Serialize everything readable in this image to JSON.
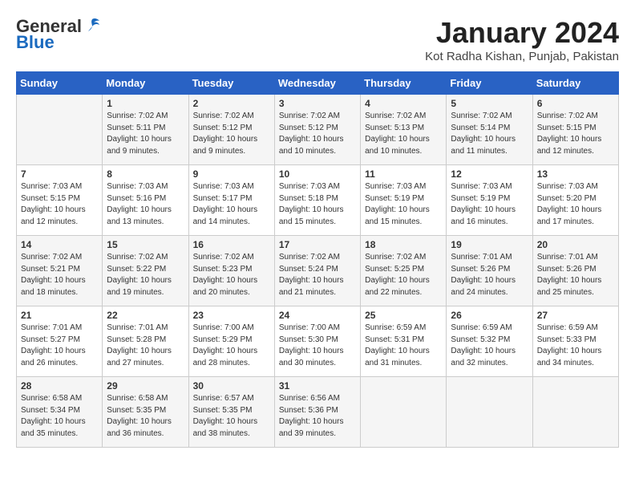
{
  "header": {
    "logo_general": "General",
    "logo_blue": "Blue",
    "month_title": "January 2024",
    "location": "Kot Radha Kishan, Punjab, Pakistan"
  },
  "calendar": {
    "days_of_week": [
      "Sunday",
      "Monday",
      "Tuesday",
      "Wednesday",
      "Thursday",
      "Friday",
      "Saturday"
    ],
    "weeks": [
      [
        {
          "day": "",
          "info": ""
        },
        {
          "day": "1",
          "info": "Sunrise: 7:02 AM\nSunset: 5:11 PM\nDaylight: 10 hours\nand 9 minutes."
        },
        {
          "day": "2",
          "info": "Sunrise: 7:02 AM\nSunset: 5:12 PM\nDaylight: 10 hours\nand 9 minutes."
        },
        {
          "day": "3",
          "info": "Sunrise: 7:02 AM\nSunset: 5:12 PM\nDaylight: 10 hours\nand 10 minutes."
        },
        {
          "day": "4",
          "info": "Sunrise: 7:02 AM\nSunset: 5:13 PM\nDaylight: 10 hours\nand 10 minutes."
        },
        {
          "day": "5",
          "info": "Sunrise: 7:02 AM\nSunset: 5:14 PM\nDaylight: 10 hours\nand 11 minutes."
        },
        {
          "day": "6",
          "info": "Sunrise: 7:02 AM\nSunset: 5:15 PM\nDaylight: 10 hours\nand 12 minutes."
        }
      ],
      [
        {
          "day": "7",
          "info": "Sunrise: 7:03 AM\nSunset: 5:15 PM\nDaylight: 10 hours\nand 12 minutes."
        },
        {
          "day": "8",
          "info": "Sunrise: 7:03 AM\nSunset: 5:16 PM\nDaylight: 10 hours\nand 13 minutes."
        },
        {
          "day": "9",
          "info": "Sunrise: 7:03 AM\nSunset: 5:17 PM\nDaylight: 10 hours\nand 14 minutes."
        },
        {
          "day": "10",
          "info": "Sunrise: 7:03 AM\nSunset: 5:18 PM\nDaylight: 10 hours\nand 15 minutes."
        },
        {
          "day": "11",
          "info": "Sunrise: 7:03 AM\nSunset: 5:19 PM\nDaylight: 10 hours\nand 15 minutes."
        },
        {
          "day": "12",
          "info": "Sunrise: 7:03 AM\nSunset: 5:19 PM\nDaylight: 10 hours\nand 16 minutes."
        },
        {
          "day": "13",
          "info": "Sunrise: 7:03 AM\nSunset: 5:20 PM\nDaylight: 10 hours\nand 17 minutes."
        }
      ],
      [
        {
          "day": "14",
          "info": "Sunrise: 7:02 AM\nSunset: 5:21 PM\nDaylight: 10 hours\nand 18 minutes."
        },
        {
          "day": "15",
          "info": "Sunrise: 7:02 AM\nSunset: 5:22 PM\nDaylight: 10 hours\nand 19 minutes."
        },
        {
          "day": "16",
          "info": "Sunrise: 7:02 AM\nSunset: 5:23 PM\nDaylight: 10 hours\nand 20 minutes."
        },
        {
          "day": "17",
          "info": "Sunrise: 7:02 AM\nSunset: 5:24 PM\nDaylight: 10 hours\nand 21 minutes."
        },
        {
          "day": "18",
          "info": "Sunrise: 7:02 AM\nSunset: 5:25 PM\nDaylight: 10 hours\nand 22 minutes."
        },
        {
          "day": "19",
          "info": "Sunrise: 7:01 AM\nSunset: 5:26 PM\nDaylight: 10 hours\nand 24 minutes."
        },
        {
          "day": "20",
          "info": "Sunrise: 7:01 AM\nSunset: 5:26 PM\nDaylight: 10 hours\nand 25 minutes."
        }
      ],
      [
        {
          "day": "21",
          "info": "Sunrise: 7:01 AM\nSunset: 5:27 PM\nDaylight: 10 hours\nand 26 minutes."
        },
        {
          "day": "22",
          "info": "Sunrise: 7:01 AM\nSunset: 5:28 PM\nDaylight: 10 hours\nand 27 minutes."
        },
        {
          "day": "23",
          "info": "Sunrise: 7:00 AM\nSunset: 5:29 PM\nDaylight: 10 hours\nand 28 minutes."
        },
        {
          "day": "24",
          "info": "Sunrise: 7:00 AM\nSunset: 5:30 PM\nDaylight: 10 hours\nand 30 minutes."
        },
        {
          "day": "25",
          "info": "Sunrise: 6:59 AM\nSunset: 5:31 PM\nDaylight: 10 hours\nand 31 minutes."
        },
        {
          "day": "26",
          "info": "Sunrise: 6:59 AM\nSunset: 5:32 PM\nDaylight: 10 hours\nand 32 minutes."
        },
        {
          "day": "27",
          "info": "Sunrise: 6:59 AM\nSunset: 5:33 PM\nDaylight: 10 hours\nand 34 minutes."
        }
      ],
      [
        {
          "day": "28",
          "info": "Sunrise: 6:58 AM\nSunset: 5:34 PM\nDaylight: 10 hours\nand 35 minutes."
        },
        {
          "day": "29",
          "info": "Sunrise: 6:58 AM\nSunset: 5:35 PM\nDaylight: 10 hours\nand 36 minutes."
        },
        {
          "day": "30",
          "info": "Sunrise: 6:57 AM\nSunset: 5:35 PM\nDaylight: 10 hours\nand 38 minutes."
        },
        {
          "day": "31",
          "info": "Sunrise: 6:56 AM\nSunset: 5:36 PM\nDaylight: 10 hours\nand 39 minutes."
        },
        {
          "day": "",
          "info": ""
        },
        {
          "day": "",
          "info": ""
        },
        {
          "day": "",
          "info": ""
        }
      ]
    ]
  }
}
